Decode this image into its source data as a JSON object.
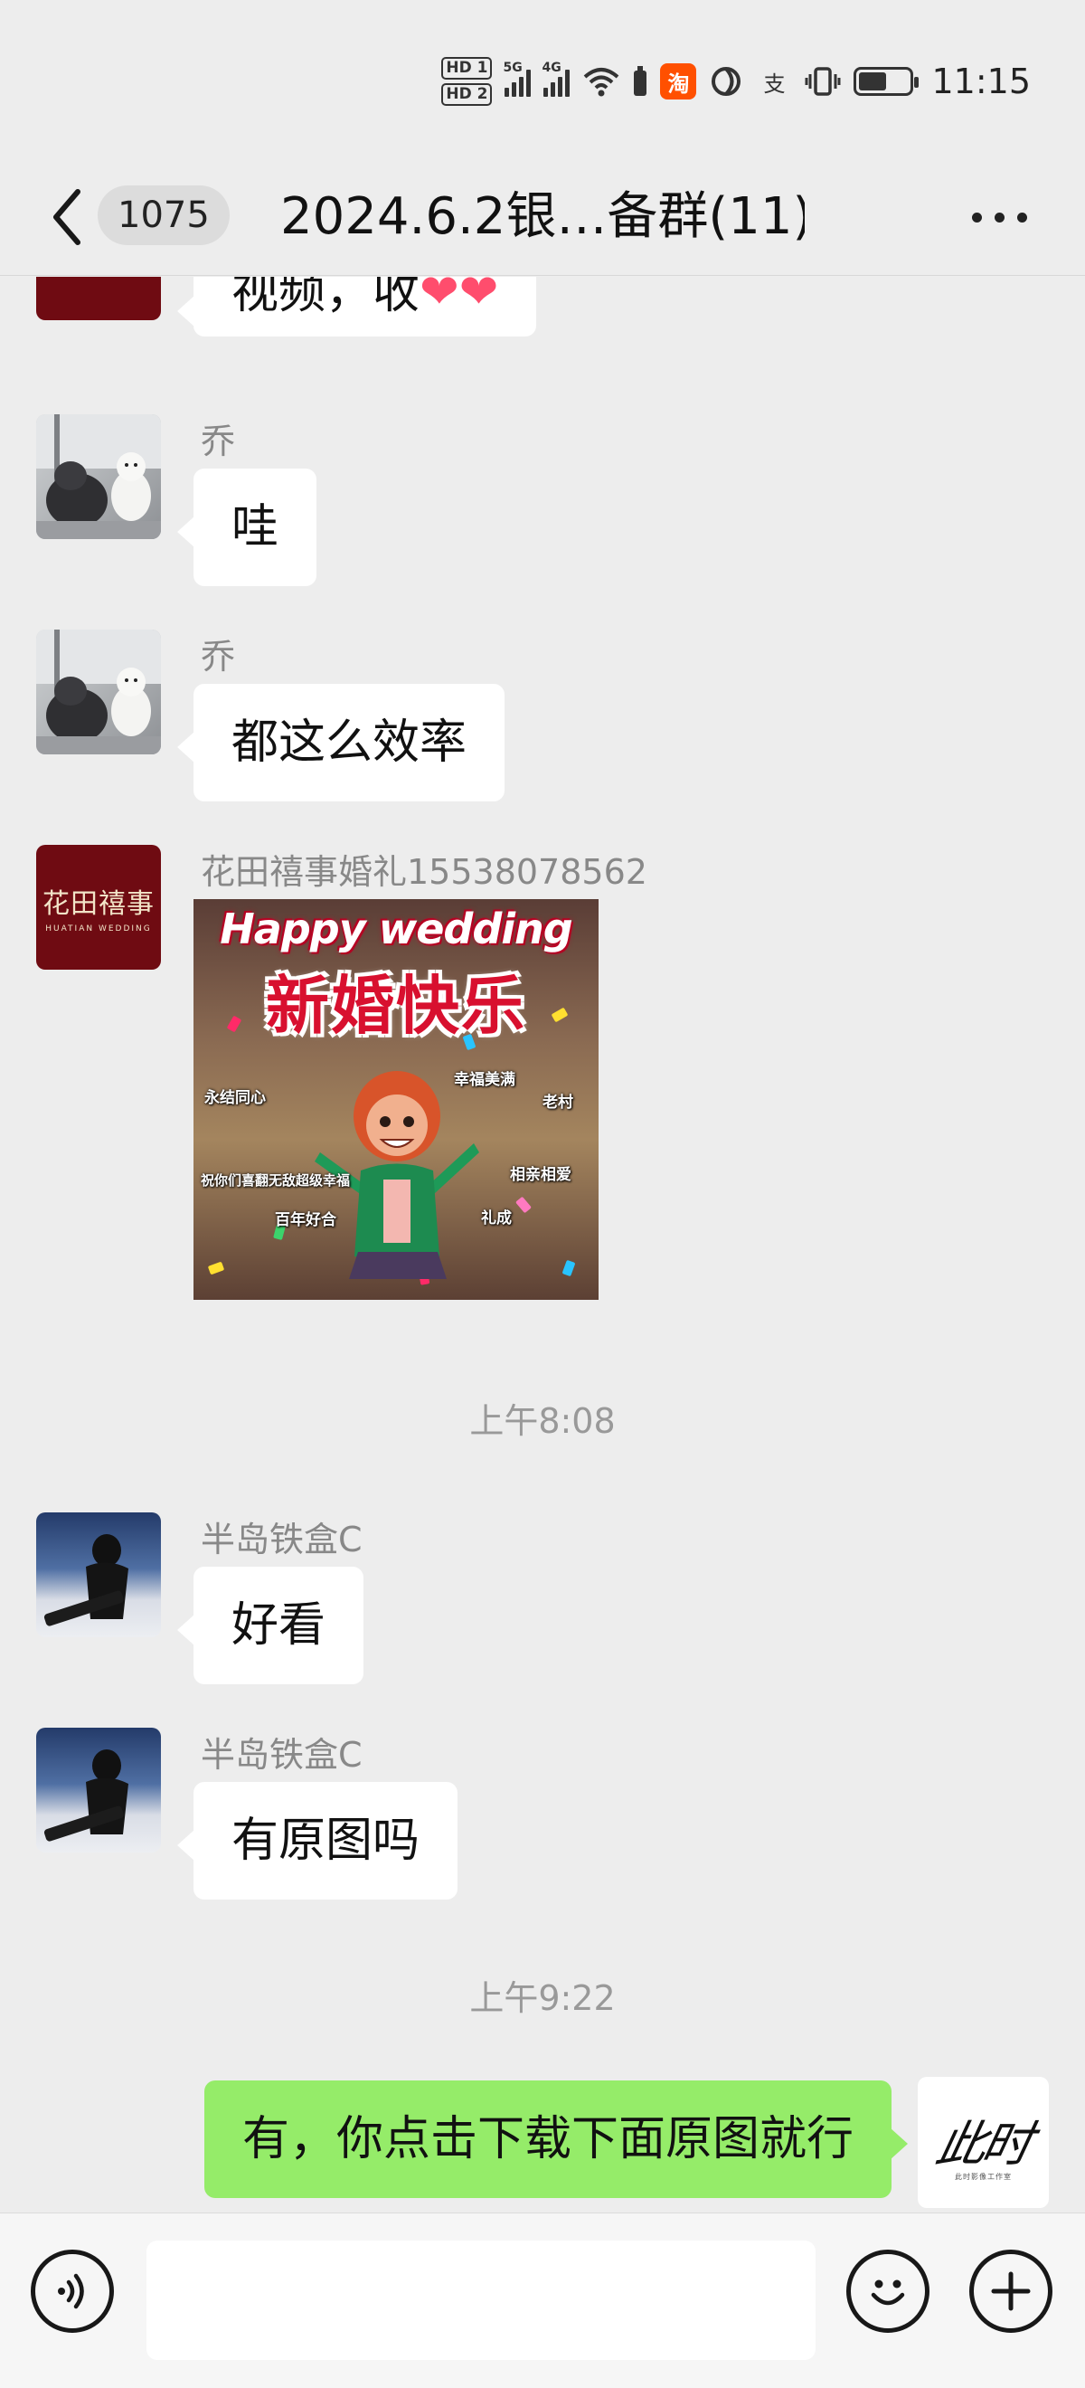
{
  "status_bar": {
    "hd_badges": [
      "HD 1",
      "HD 2"
    ],
    "network_labels": [
      "5G",
      "4G"
    ],
    "app_icons": [
      "taobao-icon",
      "sticker-icon",
      "alipay-icon"
    ],
    "taobao_label": "淘",
    "alipay_label": "支",
    "battery_level": 0.55,
    "time": "11:15"
  },
  "header": {
    "unread_count": "1075",
    "title": "2024.6.2银…备群(11)"
  },
  "messages": [
    {
      "type": "text",
      "side": "left",
      "sender": "",
      "text": "视频，收",
      "hearts": "❤❤"
    },
    {
      "type": "text",
      "side": "left",
      "sender": "乔",
      "text": "哇"
    },
    {
      "type": "text",
      "side": "left",
      "sender": "乔",
      "text": "都这么效率"
    },
    {
      "type": "image",
      "side": "left",
      "sender": "花田禧事婚礼15538078562",
      "image": {
        "headline": "Happy wedding",
        "title": "新婚快乐",
        "tags": [
          "永结同心",
          "幸福美满",
          "老村",
          "祝你们喜翻无敌超级幸福",
          "相亲相爱",
          "百年好合",
          "礼成"
        ]
      }
    },
    {
      "type": "time",
      "text": "上午8:08"
    },
    {
      "type": "text",
      "side": "left",
      "sender": "半岛铁盒C",
      "text": "好看"
    },
    {
      "type": "text",
      "side": "left",
      "sender": "半岛铁盒C",
      "text": "有原图吗"
    },
    {
      "type": "time",
      "text": "上午9:22"
    },
    {
      "type": "text",
      "side": "right",
      "text": "有，你点击下载下面原图就行"
    }
  ],
  "avatars": {
    "brand": {
      "cn": "花田禧事",
      "en": "HUATIAN WEDDING"
    },
    "self": {
      "big": "此时",
      "tiny": "此时影像工作室"
    }
  },
  "input_bar": {
    "value": "",
    "placeholder": ""
  },
  "colors": {
    "background": "#ededed",
    "bubble_self": "#95ec69",
    "bubble_other": "#ffffff"
  }
}
